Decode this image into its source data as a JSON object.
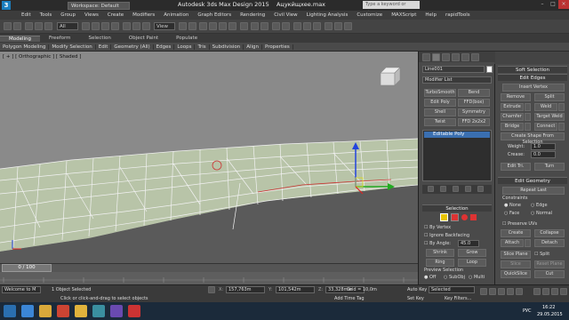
{
  "window": {
    "app_title": "Autodesk 3ds Max Design 2015",
    "file_name": "Ацукйщхее.max",
    "workspace": "Workspace: Default",
    "search_placeholder": "Type a keyword or phrase"
  },
  "menu": [
    "Edit",
    "Tools",
    "Group",
    "Views",
    "Create",
    "Modifiers",
    "Animation",
    "Graph Editors",
    "Rendering",
    "Civil View",
    "Lighting Analysis",
    "Customize",
    "MAXScript",
    "Help",
    "rapidTools"
  ],
  "toolbar": {
    "selection_filter": "All",
    "view_dropdown": "View"
  },
  "ribbon": {
    "tabs": [
      "Modeling",
      "Freeform",
      "Selection",
      "Object Paint",
      "Populate"
    ],
    "active_tab": "Modeling",
    "sub_items": [
      "Polygon Modeling",
      "Modify Selection",
      "Edit",
      "Geometry (All)",
      "Edges",
      "Loops",
      "Tris",
      "Subdivision",
      "Align",
      "Properties"
    ]
  },
  "viewport": {
    "label": "[ + ] [ Orthographic ] [ Shaded ]"
  },
  "timeline": {
    "frame": "0 / 100"
  },
  "command_panel": {
    "object_name": "Line001",
    "modifier_list": "Modifier List",
    "modifier_buttons": [
      "TurboSmooth",
      "Bend",
      "Edit Poly",
      "FFD(box)",
      "Shell",
      "Symmetry",
      "Twist",
      "FFD 2x2x2"
    ],
    "stack_item": "Editable Poly",
    "selection_header": "Selection",
    "by_vertex": "By Vertex",
    "ignore_backfacing": "Ignore Backfacing",
    "by_angle": "By Angle:",
    "angle_value": "45.0",
    "shrink": "Shrink",
    "grow": "Grow",
    "ring": "Ring",
    "loop": "Loop",
    "preview_selection": "Preview Selection",
    "preview_off": "Off",
    "preview_subobj": "SubObj",
    "preview_multi": "Multi"
  },
  "right_panel": {
    "soft_selection": "Soft Selection",
    "edit_edges": "Edit Edges",
    "insert_vertex": "Insert Vertex",
    "remove": "Remove",
    "split": "Split",
    "extrude": "Extrude",
    "weld": "Weld",
    "chamfer": "Chamfer",
    "target_weld": "Target Weld",
    "bridge": "Bridge",
    "connect": "Connect",
    "create_shape": "Create Shape From Selection",
    "weight_label": "Weight:",
    "weight_value": "1.0",
    "crease_label": "Crease:",
    "crease_value": "0.0",
    "edit_tri": "Edit Tri.",
    "turn": "Turn",
    "edit_geometry": "Edit Geometry",
    "repeat_last": "Repeat Last",
    "constraints": "Constraints",
    "c_none": "None",
    "c_edge": "Edge",
    "c_face": "Face",
    "c_normal": "Normal",
    "preserve_uvs": "Preserve UVs",
    "create": "Create",
    "collapse": "Collapse",
    "attach": "Attach",
    "detach": "Detach",
    "slice_plane": "Slice Plane",
    "split2": "Split",
    "slice": "Slice",
    "reset_plane": "Reset Plane",
    "quickslice": "QuickSlice",
    "cut": "Cut"
  },
  "status": {
    "objects_selected": "1 Object Selected",
    "hint": "Click or click-and-drag to select objects",
    "welcome": "Welcome to M",
    "x_value": "157,763m",
    "y_value": "101,542m",
    "z_value": "33,328mm",
    "grid": "Grid = 10,0m",
    "add_time_tag": "Add Time Tag",
    "auto_key": "Auto Key",
    "set_key": "Set Key",
    "selected": "Selected",
    "key_filters": "Key Filters..."
  },
  "taskbar": {
    "lang": "РУС",
    "time": "16:22",
    "date": "29.05.2015"
  }
}
